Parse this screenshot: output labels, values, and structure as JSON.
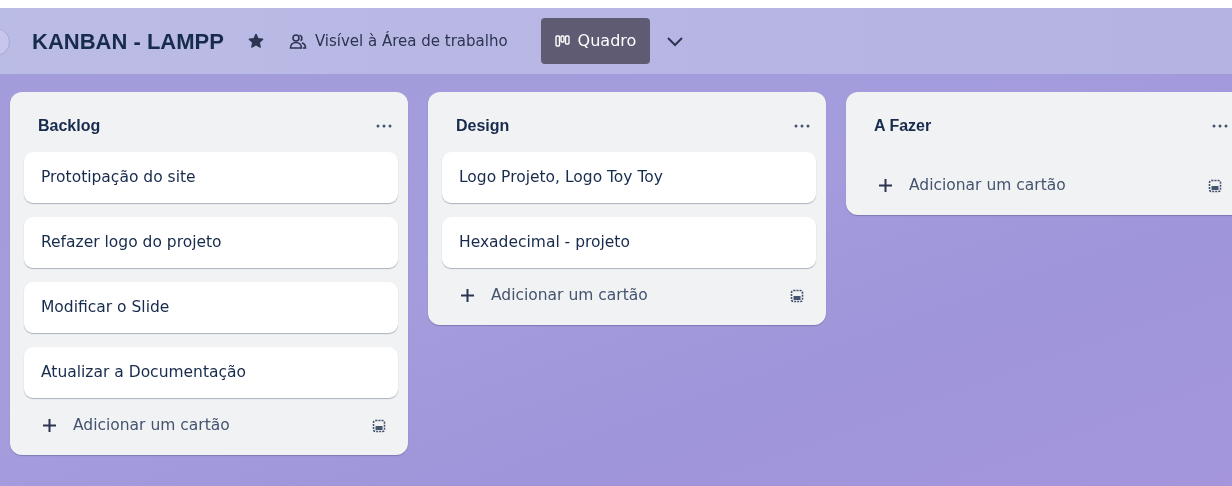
{
  "board": {
    "title": "KANBAN - LAMPP",
    "starred": true,
    "visibility": "Visível à Área de trabalho",
    "view_button": "Quadro"
  },
  "lists": [
    {
      "title": "Backlog",
      "cards": [
        "Prototipação do site",
        "Refazer logo do projeto",
        "Modificar o Slide",
        "Atualizar a Documentação"
      ],
      "add_card": "Adicionar um cartão"
    },
    {
      "title": "Design",
      "cards": [
        "Logo Projeto, Logo Toy Toy",
        "Hexadecimal - projeto"
      ],
      "add_card": "Adicionar um cartão"
    },
    {
      "title": "A Fazer",
      "add_card": "Adicionar um cartão"
    }
  ]
}
